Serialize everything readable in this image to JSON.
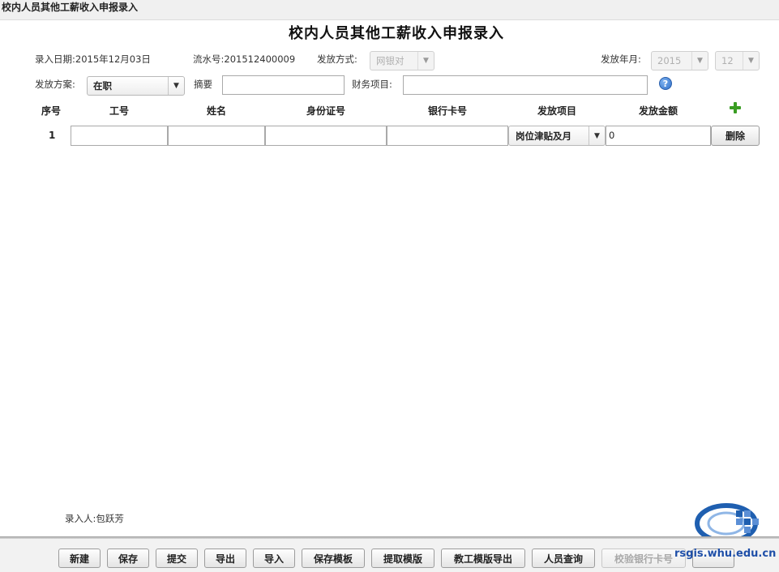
{
  "window": {
    "title": "校内人员其他工薪收入申报录入"
  },
  "page": {
    "title": "校内人员其他工薪收入申报录入"
  },
  "header": {
    "entry_date": "录入日期:2015年12月03日",
    "serial_no": "流水号:201512400009",
    "pay_method_label": "发放方式:",
    "pay_method_value": "网银对",
    "pay_year_month_label": "发放年月:",
    "year_value": "2015",
    "month_value": "12",
    "plan_label": "发放方案:",
    "plan_value": "在职",
    "summary_label": "摘要",
    "summary_value": "",
    "finance_label": "财务项目:",
    "finance_value": ""
  },
  "table": {
    "columns": [
      "序号",
      "工号",
      "姓名",
      "身份证号",
      "银行卡号",
      "发放项目",
      "发放金额"
    ],
    "rows": [
      {
        "index": "1",
        "emp_no": "",
        "name": "",
        "id_no": "",
        "bank_card": "",
        "pay_item": "岗位津贴及月",
        "amount": "0",
        "delete_label": "删除"
      }
    ]
  },
  "footer": {
    "recorder": "录入人:包跃芳",
    "buttons": {
      "new": "新建",
      "save": "保存",
      "submit": "提交",
      "export": "导出",
      "import": "导入",
      "save_template": "保存模板",
      "fetch_template": "提取模版",
      "staff_template_export": "教工模版导出",
      "person_query": "人员查询",
      "verify_bank_card": "校验银行卡号"
    },
    "watermark": "rsgis.whu.edu.cn"
  },
  "icons": {
    "help": "help-icon",
    "add": "add-row-icon",
    "dropdown": "chevron-down-icon"
  },
  "colors": {
    "add_icon": "#3a9d23",
    "help_icon": "#2f6fc9",
    "watermark": "#1f4fa8"
  }
}
